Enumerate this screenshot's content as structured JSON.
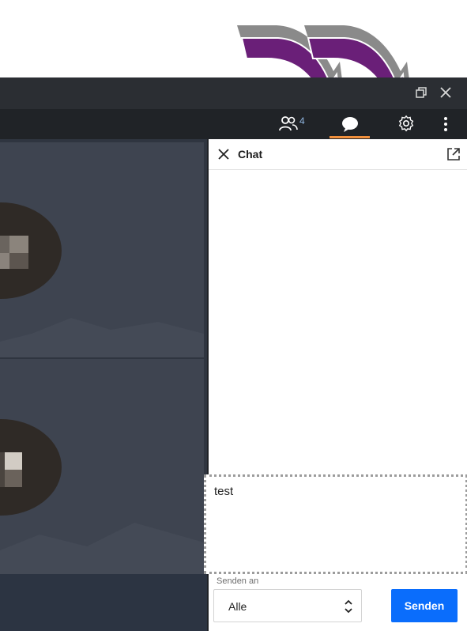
{
  "toolbar": {
    "participants_count": "4",
    "participants_icon": "people-icon",
    "chat_icon": "chat-bubble-icon",
    "settings_icon": "gear-icon",
    "more_icon": "more-vertical-icon",
    "active_tab_color": "#f08f3c"
  },
  "window_controls": {
    "restore_icon": "restore-icon",
    "close_icon": "close-icon"
  },
  "annotation_arrows": {
    "color": "#6a1f78",
    "shadow_color": "#7f7f7f"
  },
  "chat": {
    "title": "Chat",
    "close_icon": "close-icon",
    "popout_icon": "external-link-icon",
    "compose_text": "test",
    "send_to_label": "Senden an",
    "recipient_value": "Alle",
    "send_button_label": "Senden",
    "send_button_color": "#0a6dfc"
  }
}
